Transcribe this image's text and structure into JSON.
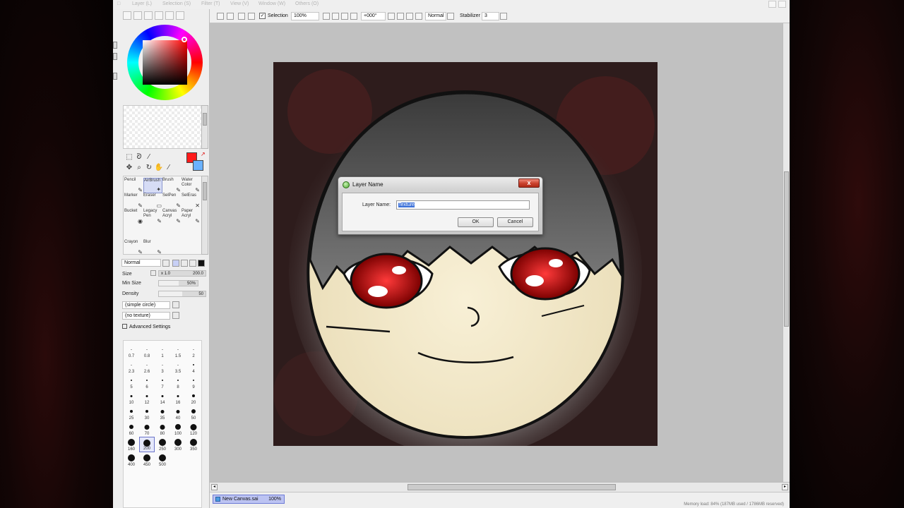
{
  "menubar": {
    "items": [
      "Layer (L)",
      "Selection (S)",
      "Filter (T)",
      "View (V)",
      "Window (W)",
      "Others (O)"
    ]
  },
  "toolbar": {
    "selection_label": "Selection",
    "zoom": "100%",
    "rotation": "+000°",
    "blend": "Normal",
    "stabilizer_label": "Stabilizer",
    "stabilizer_value": "3"
  },
  "tools": {
    "foreground_color": "#ff1a1a",
    "background_color": "#6ab2ff",
    "brushes": [
      {
        "label": "Pencil",
        "selected": false
      },
      {
        "label": "AirBrush",
        "selected": true
      },
      {
        "label": "Brush",
        "selected": false
      },
      {
        "label": "Water Color",
        "selected": false
      },
      {
        "label": "Marker",
        "selected": false
      },
      {
        "label": "Eraser",
        "selected": false
      },
      {
        "label": "SelPen",
        "selected": false
      },
      {
        "label": "SelEras",
        "selected": false
      },
      {
        "label": "Bucket",
        "selected": false
      },
      {
        "label": "Legacy Pen",
        "selected": false
      },
      {
        "label": "Canvas Acryl",
        "selected": false
      },
      {
        "label": "Paper Acryl",
        "selected": false
      },
      {
        "label": "Crayon",
        "selected": false
      },
      {
        "label": "Blur",
        "selected": false
      }
    ]
  },
  "brush_props": {
    "blend_mode": "Normal",
    "size_label": "Size",
    "size_multiplier": "x 1.0",
    "size_value": "200.0",
    "min_size_label": "Min Size",
    "min_size_value": "50%",
    "min_size_fraction": 0.5,
    "density_label": "Density",
    "density_value": "50",
    "density_fraction": 0.5,
    "shape": "(simple circle)",
    "texture": "(no texture)",
    "advanced_label": "Advanced Settings"
  },
  "brush_sizes": {
    "values": [
      "0.7",
      "0.8",
      "1",
      "1.5",
      "2",
      "2.3",
      "2.6",
      "3",
      "3.5",
      "4",
      "5",
      "6",
      "7",
      "8",
      "9",
      "10",
      "12",
      "14",
      "16",
      "20",
      "25",
      "30",
      "35",
      "40",
      "50",
      "60",
      "70",
      "80",
      "100",
      "120",
      "160",
      "200",
      "250",
      "300",
      "350",
      "400",
      "450",
      "500"
    ],
    "selected": "200"
  },
  "dialog": {
    "title": "Layer Name",
    "close_label": "x",
    "field_label": "Layer Name:",
    "field_value": "Texture",
    "ok_label": "OK",
    "cancel_label": "Cancel"
  },
  "document": {
    "name": "New Canvas.sai",
    "zoom": "100%"
  },
  "status": {
    "info": "Memory load: 84% (187MB used / 1786MB reserved)"
  }
}
